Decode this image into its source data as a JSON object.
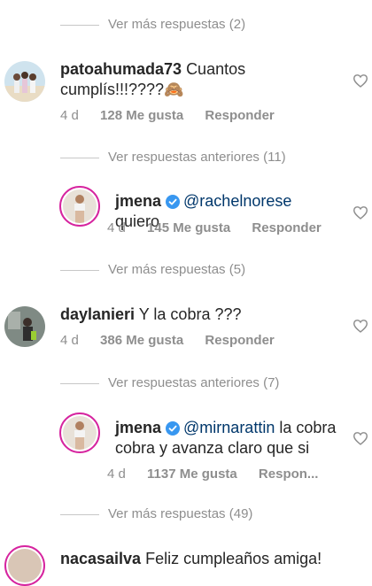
{
  "threads": [
    {
      "more_label": "Ver más respuestas (2)"
    },
    {
      "more_label": "Ver respuestas anteriores (11)"
    },
    {
      "more_label": "Ver más respuestas (5)"
    },
    {
      "more_label": "Ver respuestas anteriores (7)"
    },
    {
      "more_label": "Ver más respuestas (49)"
    }
  ],
  "comments": [
    {
      "username": "patoahumada73",
      "text": "Cuantos cumplís!!!????",
      "emoji": "🙈",
      "time": "4 d",
      "likes": "128 Me gusta",
      "reply": "Responder"
    },
    {
      "username": "jmena",
      "verified": true,
      "mention": "@rachelnorese",
      "text": "quiero",
      "time": "4 d",
      "likes": "145 Me gusta",
      "reply": "Responder"
    },
    {
      "username": "daylanieri",
      "text": "Y la cobra ???",
      "time": "4 d",
      "likes": "386 Me gusta",
      "reply": "Responder"
    },
    {
      "username": "jmena",
      "verified": true,
      "mention": "@mirnarattin",
      "text": "la cobra cobra y avanza claro que si",
      "time": "4 d",
      "likes": "1137 Me gusta",
      "reply": "Respon..."
    },
    {
      "username": "nacasailva",
      "text": "Feliz cumpleaños amiga!"
    }
  ],
  "colors": {
    "text": "#262626",
    "secondary": "#8e8e8e",
    "mention": "#00376b",
    "verified": "#3897f0",
    "story_ring": "#d6249f"
  },
  "icons": [
    "heart-icon",
    "verified-badge-icon"
  ]
}
